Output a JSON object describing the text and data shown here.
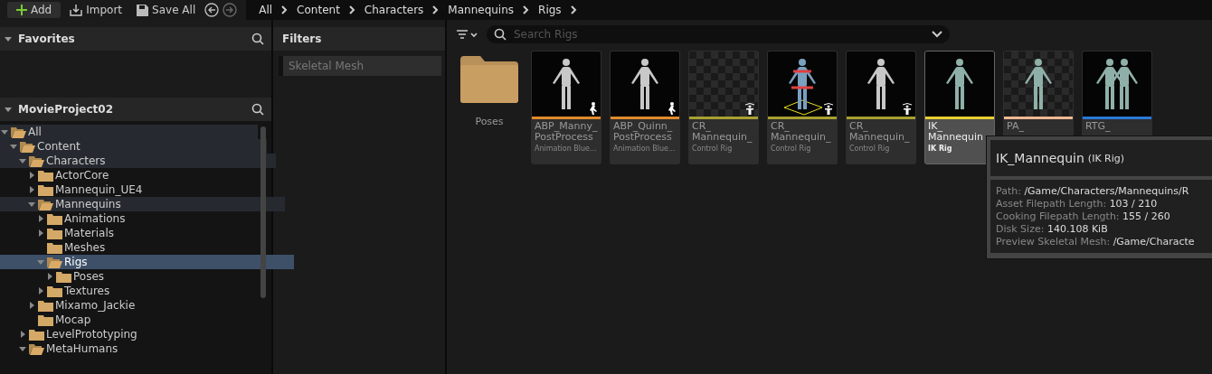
{
  "toolbar": {
    "add": "Add",
    "import": "Import",
    "save_all": "Save All"
  },
  "breadcrumb": [
    "All",
    "Content",
    "Characters",
    "Mannequins",
    "Rigs"
  ],
  "favorites": {
    "title": "Favorites"
  },
  "project": {
    "title": "MovieProject02"
  },
  "tree": [
    {
      "label": "All",
      "has_children": true,
      "expanded": true,
      "selected": false,
      "on_path": true,
      "children": [
        {
          "label": "Content",
          "has_children": true,
          "expanded": true,
          "selected": false,
          "on_path": true,
          "children": [
            {
              "label": "Characters",
              "has_children": true,
              "expanded": true,
              "selected": false,
              "on_path": true,
              "children": [
                {
                  "label": "ActorCore",
                  "has_children": true,
                  "expanded": false,
                  "selected": false,
                  "on_path": false
                },
                {
                  "label": "Mannequin_UE4",
                  "has_children": true,
                  "expanded": false,
                  "selected": false,
                  "on_path": false
                },
                {
                  "label": "Mannequins",
                  "has_children": true,
                  "expanded": true,
                  "selected": false,
                  "on_path": true,
                  "children": [
                    {
                      "label": "Animations",
                      "has_children": true,
                      "expanded": false,
                      "selected": false,
                      "on_path": false
                    },
                    {
                      "label": "Materials",
                      "has_children": true,
                      "expanded": false,
                      "selected": false,
                      "on_path": false
                    },
                    {
                      "label": "Meshes",
                      "has_children": false,
                      "expanded": false,
                      "selected": false,
                      "on_path": false
                    },
                    {
                      "label": "Rigs",
                      "has_children": true,
                      "expanded": true,
                      "selected": true,
                      "on_path": false,
                      "children": [
                        {
                          "label": "Poses",
                          "has_children": true,
                          "expanded": false,
                          "selected": false,
                          "on_path": false
                        }
                      ]
                    },
                    {
                      "label": "Textures",
                      "has_children": true,
                      "expanded": false,
                      "selected": false,
                      "on_path": false
                    }
                  ]
                },
                {
                  "label": "Mixamo_Jackie",
                  "has_children": true,
                  "expanded": false,
                  "selected": false,
                  "on_path": false
                },
                {
                  "label": "Mocap",
                  "has_children": false,
                  "expanded": false,
                  "selected": false,
                  "on_path": false
                }
              ]
            },
            {
              "label": "LevelPrototyping",
              "has_children": true,
              "expanded": false,
              "selected": false,
              "on_path": false
            },
            {
              "label": "MetaHumans",
              "has_children": true,
              "expanded": true,
              "selected": false,
              "on_path": false
            }
          ]
        }
      ]
    }
  ],
  "filters": {
    "title": "Filters",
    "items": [
      "Skeletal Mesh"
    ]
  },
  "search": {
    "placeholder": "Search Rigs"
  },
  "folders": [
    {
      "label": "Poses"
    }
  ],
  "assets": [
    {
      "lines": [
        "ABP_Manny_",
        "PostProcess"
      ],
      "type": "Animation Blue...",
      "color": "#e08a2c",
      "thumbnail": {
        "kind": "mannequin"
      },
      "badge": {
        "kind": "run"
      },
      "selected": false
    },
    {
      "lines": [
        "ABP_Quinn_",
        "PostProcess"
      ],
      "type": "Animation Blue...",
      "color": "#e08a2c",
      "thumbnail": {
        "kind": "mannequin"
      },
      "badge": {
        "kind": "run"
      },
      "selected": false
    },
    {
      "lines": [
        "CR_",
        "Mannequin_"
      ],
      "type": "Control Rig",
      "color": "#a8a030",
      "thumbnail": {
        "kind": "empty"
      },
      "badge": {
        "kind": "figure"
      },
      "selected": false
    },
    {
      "lines": [
        "CR_",
        "Mannequin_"
      ],
      "type": "Control Rig",
      "color": "#a8a030",
      "thumbnail": {
        "kind": "colored"
      },
      "badge": {
        "kind": "figure"
      },
      "selected": false
    },
    {
      "lines": [
        "CR_",
        "Mannequin_"
      ],
      "type": "Control Rig",
      "color": "#a8a030",
      "thumbnail": {
        "kind": "mannequin"
      },
      "badge": {
        "kind": "figure"
      },
      "selected": false
    },
    {
      "lines": [
        "IK_",
        "Mannequin"
      ],
      "type": "IK Rig",
      "color": "#e8d030",
      "thumbnail": {
        "kind": "teal"
      },
      "selected": true
    },
    {
      "lines": [
        "PA_"
      ],
      "color": "#f0b890",
      "thumbnail": {
        "kind": "teal-check"
      },
      "selected": false
    },
    {
      "lines": [
        "RTG_"
      ],
      "color": "#2a7ad8",
      "thumbnail": {
        "kind": "pair"
      },
      "selected": false
    }
  ],
  "tooltip": {
    "title": "IK_Mannequin",
    "kind": "(IK Rig)",
    "rows": [
      {
        "label": "Path:",
        "value": "/Game/Characters/Mannequins/R"
      },
      {
        "label": "Asset Filepath Length:",
        "value": "103 / 210"
      },
      {
        "label": "Cooking Filepath Length:",
        "value": "155 / 260"
      },
      {
        "label": "Disk Size:",
        "value": "140.108 KiB"
      },
      {
        "label": "Preview Skeletal Mesh:",
        "value": "/Game/Characte"
      }
    ]
  }
}
